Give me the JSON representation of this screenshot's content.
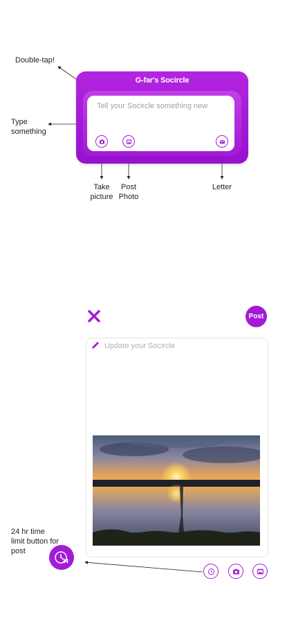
{
  "annotations": {
    "double_tap": "Double-tap!",
    "type_something": "Type something",
    "take_picture": "Take picture",
    "post_photo": "Post Photo",
    "letter": "Letter",
    "timer_note": "24 hr time limit button for post"
  },
  "widget": {
    "title": "G-far's Socircle",
    "placeholder": "Tell your Socircle something new"
  },
  "composer": {
    "post_label": "Post",
    "placeholder": "Update your Socircle",
    "timer_badge": "24"
  },
  "colors": {
    "accent": "#a21bd6",
    "widget_top": "#b425e0"
  },
  "icons": [
    "camera-icon",
    "photo-icon",
    "letter-icon",
    "close-icon",
    "pencil-icon",
    "timer-icon"
  ]
}
